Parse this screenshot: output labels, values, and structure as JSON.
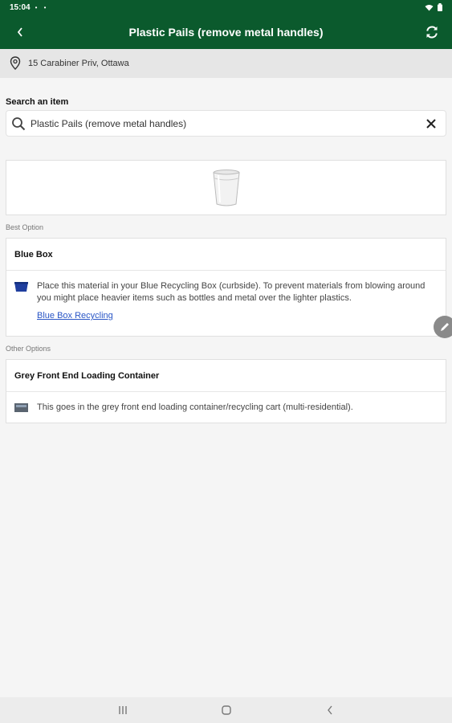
{
  "status_bar": {
    "time": "15:04",
    "notif_dots": "• •"
  },
  "app_bar": {
    "title": "Plastic Pails (remove metal handles)"
  },
  "address": {
    "text": "15 Carabiner Priv, Ottawa"
  },
  "search": {
    "label": "Search an item",
    "value": "Plastic Pails (remove metal handles)"
  },
  "best_option": {
    "section_label": "Best Option",
    "title": "Blue Box",
    "description": "Place this material in your Blue Recycling Box (curbside). To prevent materials from blowing around you might place heavier items such as bottles and metal over the lighter plastics.",
    "link": "Blue Box Recycling",
    "icon_color": "#1f3e9e"
  },
  "other_options": {
    "section_label": "Other Options",
    "title": "Grey Front End Loading Container",
    "description": "This goes in the grey front end loading container/recycling cart (multi-residential).",
    "icon_color": "#5a6470"
  },
  "colors": {
    "header": "#0b5a2d",
    "link": "#2a56c6"
  },
  "icons": [
    "back-arrow-icon",
    "refresh-icon",
    "location-pin-icon",
    "search-icon",
    "close-icon",
    "pail-image",
    "blue-bin-icon",
    "grey-bin-icon",
    "pencil-icon",
    "recents-icon",
    "home-icon",
    "nav-back-icon"
  ]
}
